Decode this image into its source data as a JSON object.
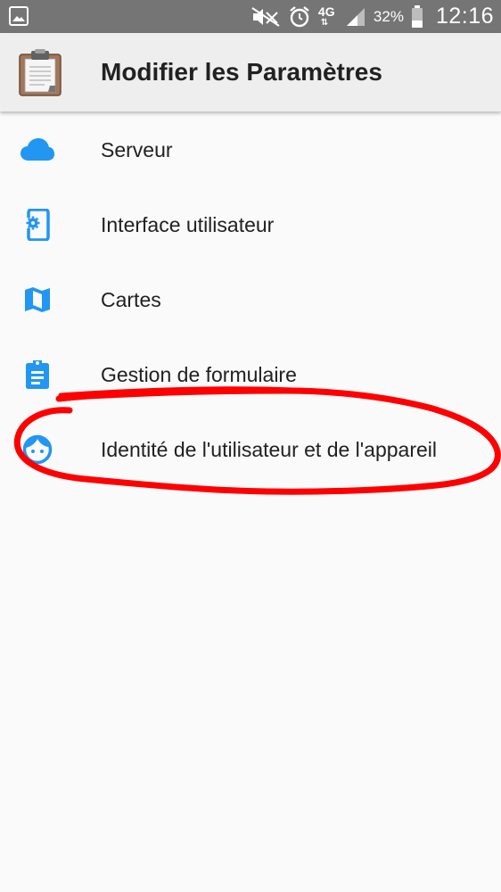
{
  "status_bar": {
    "network_label": "4G",
    "battery_percent": "32%",
    "time": "12:16",
    "icons": [
      "image-icon",
      "mute-icon",
      "alarm-icon",
      "signal-icon",
      "battery-icon"
    ]
  },
  "app_bar": {
    "title": "Modifier les Paramètres",
    "icon": "clipboard-icon"
  },
  "settings": {
    "items": [
      {
        "label": "Serveur",
        "icon": "cloud-icon"
      },
      {
        "label": "Interface utilisateur",
        "icon": "phone-settings-icon"
      },
      {
        "label": "Cartes",
        "icon": "map-icon"
      },
      {
        "label": "Gestion de formulaire",
        "icon": "form-clipboard-icon"
      },
      {
        "label": "Identité de l'utilisateur et de l'appareil",
        "icon": "face-icon"
      }
    ]
  },
  "colors": {
    "status_bar_bg": "#757575",
    "app_bar_bg": "#eeeeee",
    "page_bg": "#fafafa",
    "icon_accent": "#2196f3",
    "annotation_red": "#ff0000"
  }
}
